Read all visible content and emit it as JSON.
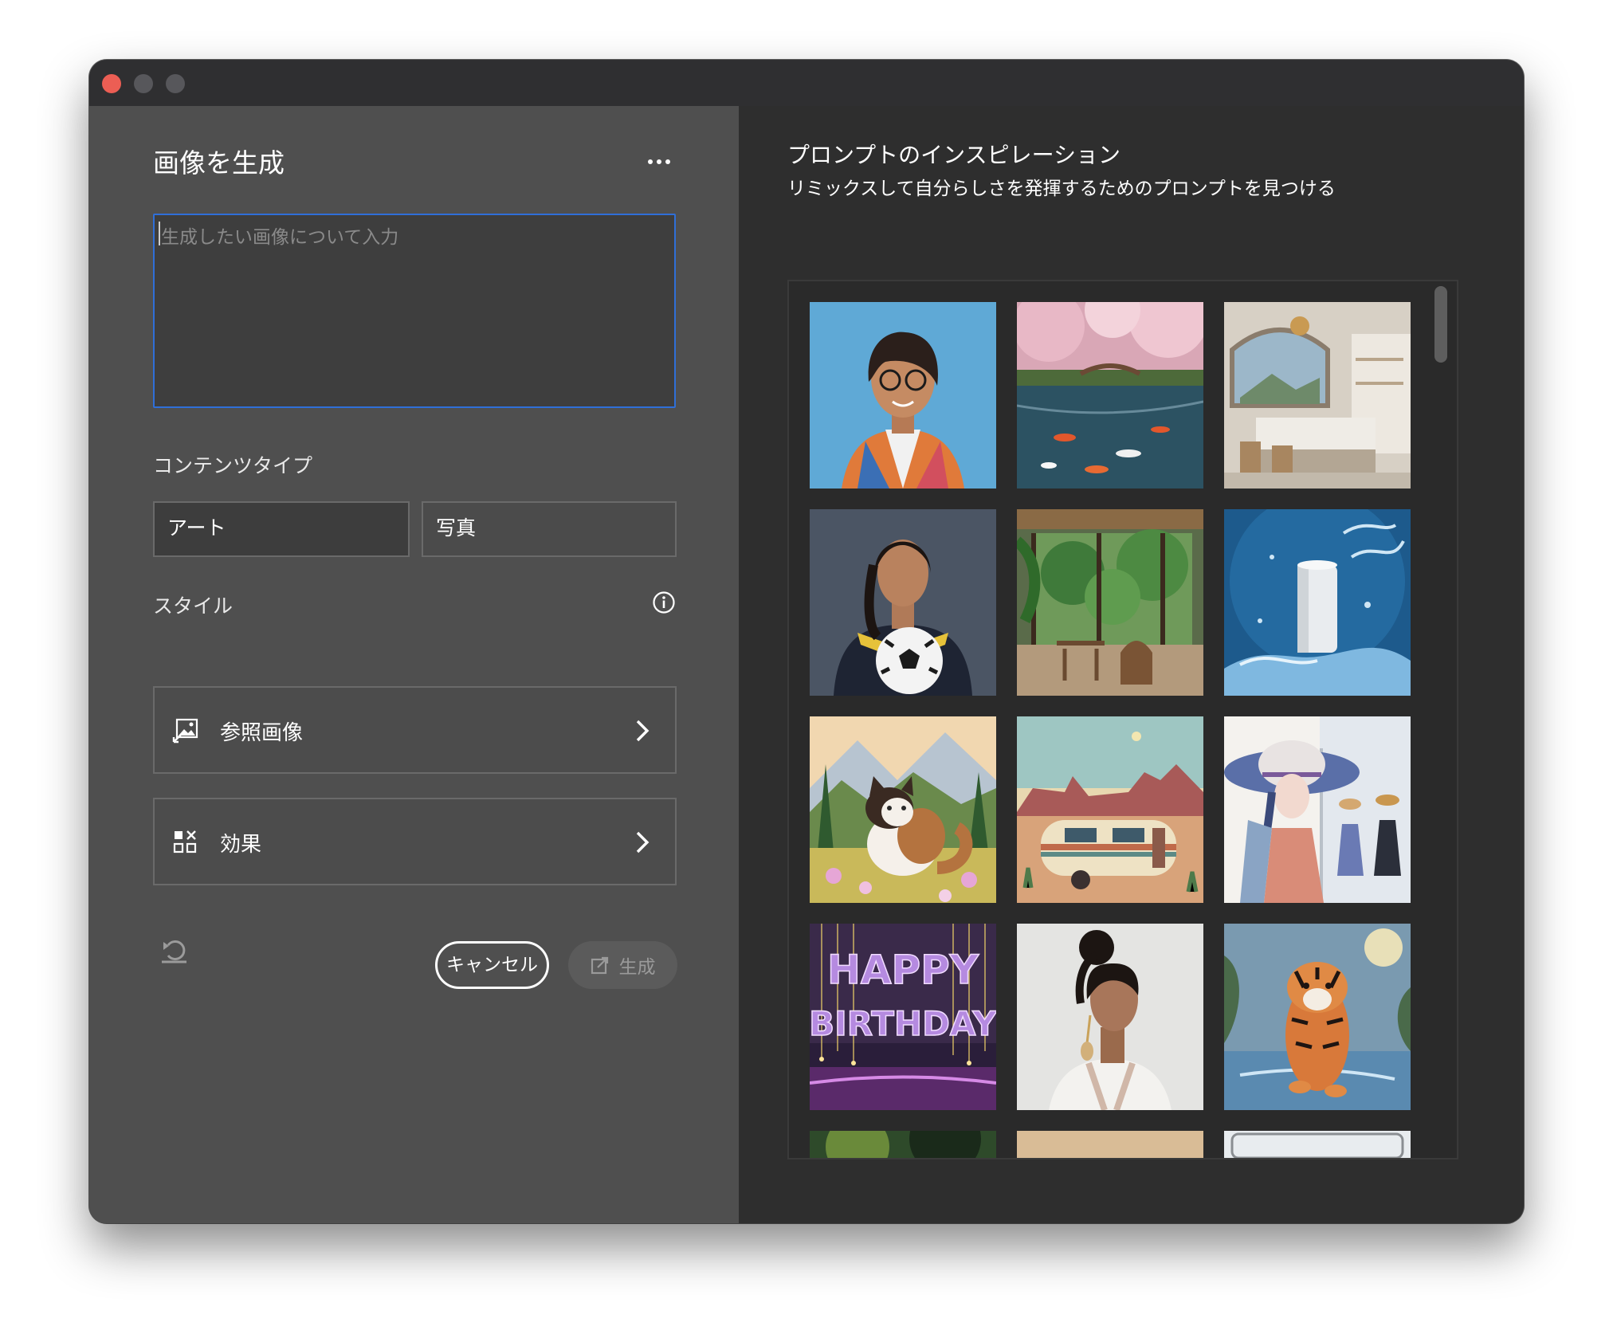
{
  "window": {
    "controls": [
      "close",
      "minimize",
      "zoom"
    ]
  },
  "left_panel": {
    "title": "画像を生成",
    "prompt": {
      "placeholder": "生成したい画像について入力",
      "value": ""
    },
    "content_type": {
      "label": "コンテンツタイプ",
      "options": [
        "アート",
        "写真"
      ]
    },
    "style": {
      "label": "スタイル",
      "reference_image_label": "参照画像",
      "effects_label": "効果"
    },
    "actions": {
      "cancel_label": "キャンセル",
      "generate_label": "生成"
    }
  },
  "right_panel": {
    "title": "プロンプトのインスピレーション",
    "subtitle": "リミックスして自分らしさを発揮するためのプロンプトを見つける",
    "gallery": [
      {
        "icon": "portrait-glasses-woman"
      },
      {
        "icon": "cherry-blossom-koi-river"
      },
      {
        "icon": "modern-kitchen"
      },
      {
        "icon": "woman-soccer-ball"
      },
      {
        "icon": "jungle-veranda"
      },
      {
        "icon": "can-water-splash"
      },
      {
        "icon": "cat-in-meadow"
      },
      {
        "icon": "retro-camper-desert"
      },
      {
        "icon": "watercolor-fashion-women"
      },
      {
        "icon": "happy-birthday-balloons",
        "text": "HAPPY BIRTHDAY"
      },
      {
        "icon": "woman-portrait-bun"
      },
      {
        "icon": "tiger-in-water"
      },
      {
        "icon": "partial-tile"
      },
      {
        "icon": "partial-tile"
      },
      {
        "icon": "partial-tile"
      }
    ]
  }
}
